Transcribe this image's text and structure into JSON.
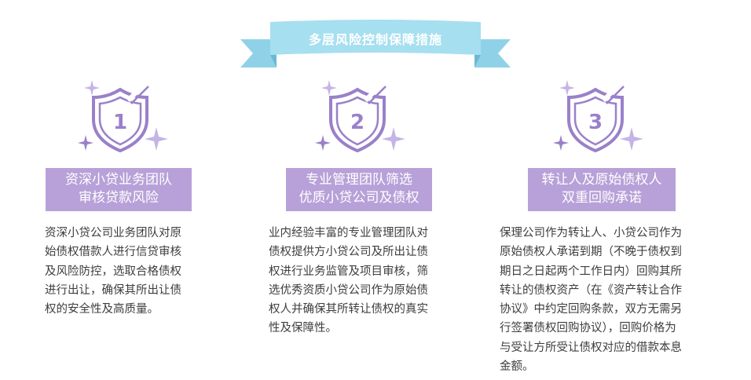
{
  "banner": {
    "title": "多层风险控制保障措施"
  },
  "colors": {
    "ribbon": "#a6dff0",
    "ribbon_dark": "#7fc9e0",
    "purple": "#b7a1d8",
    "icon": "#9a80c9",
    "sparkle": "#c5b4e6"
  },
  "steps": [
    {
      "number": "1",
      "icon": "shield-icon",
      "title_lines": [
        "资深小贷业务团队",
        "审核贷款风险"
      ],
      "desc_lines": [
        "资深小贷公司业务团队对原",
        "始债权借款人进行信贷审核",
        "及风险防控，选取合格债权",
        "进行出让，确保其所出让债",
        "权的安全性及高质量。"
      ]
    },
    {
      "number": "2",
      "icon": "shield-icon",
      "title_lines": [
        "专业管理团队筛选",
        "优质小贷公司及债权"
      ],
      "desc_lines": [
        "业内经验丰富的专业管理团队对",
        "债权提供方小贷公司及所出让债",
        "权进行业务监管及项目审核，筛",
        "选优秀资质小贷公司作为原始债",
        "权人并确保其所转让债权的真实",
        "性及保障性。"
      ]
    },
    {
      "number": "3",
      "icon": "shield-icon",
      "title_lines": [
        "转让人及原始债权人",
        "双重回购承诺"
      ],
      "desc_lines": [
        "保理公司作为转让人、小贷公司作为",
        "原始债权人承诺到期（不晚于债权到",
        "期日之日起两个工作日内）回购其所",
        "转让的债权资产（在《资产转让合作",
        "协议》中约定回购条款，双方无需另",
        "行签署债权回购协议），回购价格为",
        "与受让方所受让债权对应的借款本息",
        "金额。"
      ]
    }
  ]
}
